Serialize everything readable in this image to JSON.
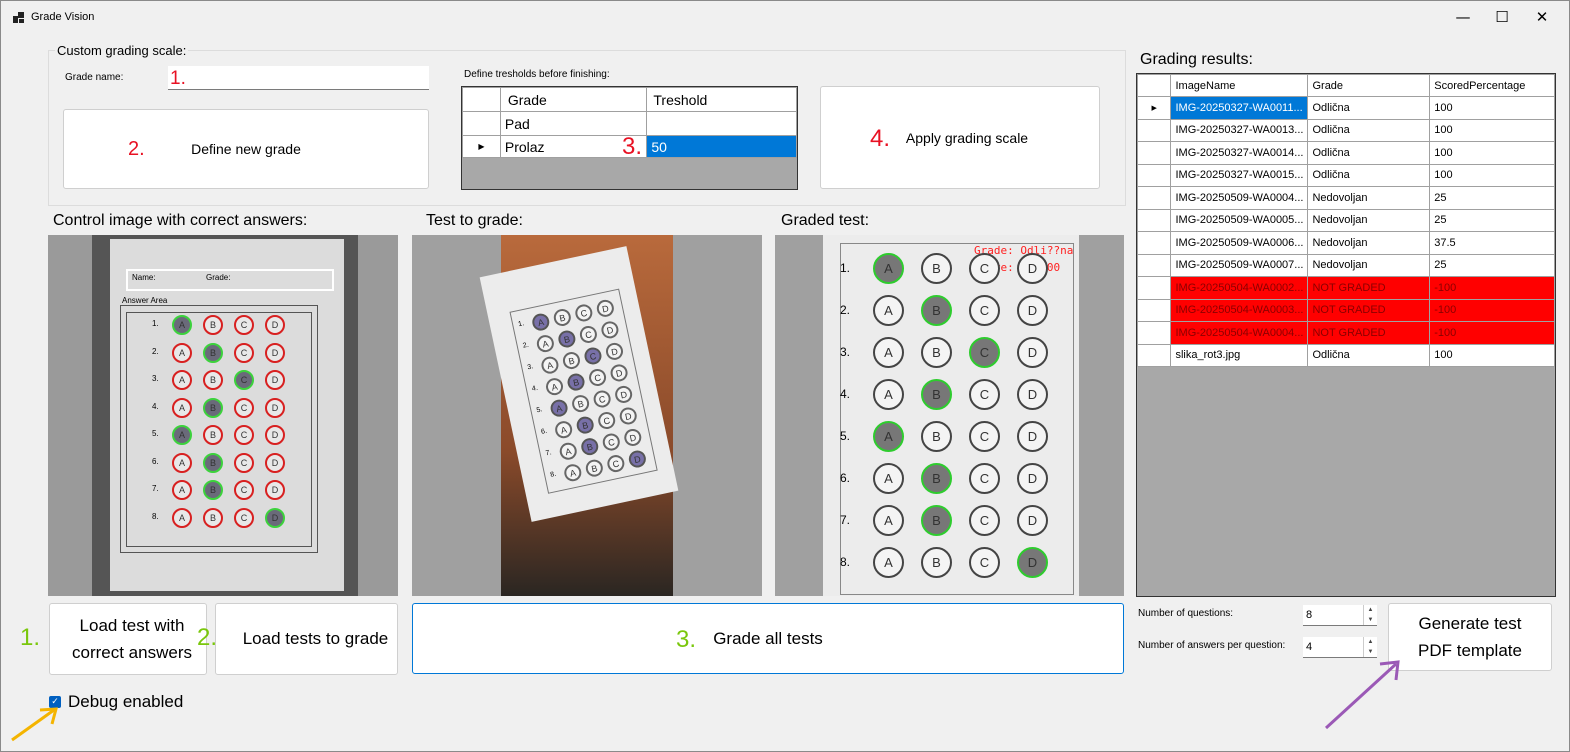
{
  "window": {
    "title": "Grade Vision",
    "minimize": "—",
    "maximize": "☐",
    "close": "✕"
  },
  "custom_scale": {
    "title": "Custom grading scale:",
    "grade_name_label": "Grade name:",
    "grade_name_value": "",
    "define_button": "Define new grade",
    "thresholds_label": "Define tresholds before finishing:",
    "columns": [
      "Grade",
      "Treshold"
    ],
    "rows": [
      {
        "grade": "Pad",
        "threshold": ""
      },
      {
        "grade": "Prolaz",
        "threshold": "50"
      }
    ],
    "apply_button": "Apply grading scale"
  },
  "annotations": {
    "n1": "1.",
    "n2": "2.",
    "n3": "3.",
    "n4": "4."
  },
  "panels": {
    "control": "Control image with correct answers:",
    "to_grade": "Test to grade:",
    "graded": "Graded test:"
  },
  "graded_overlay": {
    "grade": "Grade: Odli??na",
    "score": "Score: 100.00"
  },
  "sheet": {
    "name_label": "Name:",
    "grade_label": "Grade:",
    "answer_area": "Answer Area",
    "answers": [
      "A",
      "B",
      "C",
      "D"
    ],
    "question_numbers": [
      "1.",
      "2.",
      "3.",
      "4.",
      "5.",
      "6.",
      "7.",
      "8."
    ]
  },
  "actions": {
    "load_correct": "Load test with correct answers",
    "load_tests": "Load tests to grade",
    "grade_all": "Grade all tests",
    "debug": "Debug enabled",
    "debug_checked": true
  },
  "results": {
    "title": "Grading results:",
    "columns": [
      "ImageName",
      "Grade",
      "ScoredPercentage"
    ],
    "rows": [
      {
        "name": "IMG-20250327-WA0011...",
        "grade": "Odlična",
        "pct": "100",
        "status": "selected"
      },
      {
        "name": "IMG-20250327-WA0013...",
        "grade": "Odlična",
        "pct": "100",
        "status": "ok"
      },
      {
        "name": "IMG-20250327-WA0014...",
        "grade": "Odlična",
        "pct": "100",
        "status": "ok"
      },
      {
        "name": "IMG-20250327-WA0015...",
        "grade": "Odlična",
        "pct": "100",
        "status": "ok"
      },
      {
        "name": "IMG-20250509-WA0004...",
        "grade": "Nedovoljan",
        "pct": "25",
        "status": "ok"
      },
      {
        "name": "IMG-20250509-WA0005...",
        "grade": "Nedovoljan",
        "pct": "25",
        "status": "ok"
      },
      {
        "name": "IMG-20250509-WA0006...",
        "grade": "Nedovoljan",
        "pct": "37.5",
        "status": "ok"
      },
      {
        "name": "IMG-20250509-WA0007...",
        "grade": "Nedovoljan",
        "pct": "25",
        "status": "ok"
      },
      {
        "name": "IMG-20250504-WA0002...",
        "grade": "NOT GRADED",
        "pct": "-100",
        "status": "error"
      },
      {
        "name": "IMG-20250504-WA0003...",
        "grade": "NOT GRADED",
        "pct": "-100",
        "status": "error"
      },
      {
        "name": "IMG-20250504-WA0004...",
        "grade": "NOT GRADED",
        "pct": "-100",
        "status": "error"
      },
      {
        "name": "slika_rot3.jpg",
        "grade": "Odlična",
        "pct": "100",
        "status": "ok"
      }
    ]
  },
  "settings": {
    "num_questions_label": "Number of questions:",
    "num_questions": "8",
    "num_answers_label": "Number of answers per question:",
    "num_answers": "4",
    "generate_pdf": "Generate test PDF template"
  },
  "colors": {
    "selection": "#0078d7",
    "error_row": "#ff0000",
    "red_annotation": "#e81123",
    "green_annotation": "#7ac70c",
    "arrow_yellow": "#f4b400",
    "arrow_purple": "#9b59b6"
  },
  "icons": [
    "app-icon",
    "minimize-icon",
    "maximize-icon",
    "close-icon",
    "row-pointer-icon",
    "checkbox-icon",
    "spin-up-icon",
    "spin-down-icon",
    "yellow-arrow-icon",
    "purple-arrow-icon"
  ]
}
